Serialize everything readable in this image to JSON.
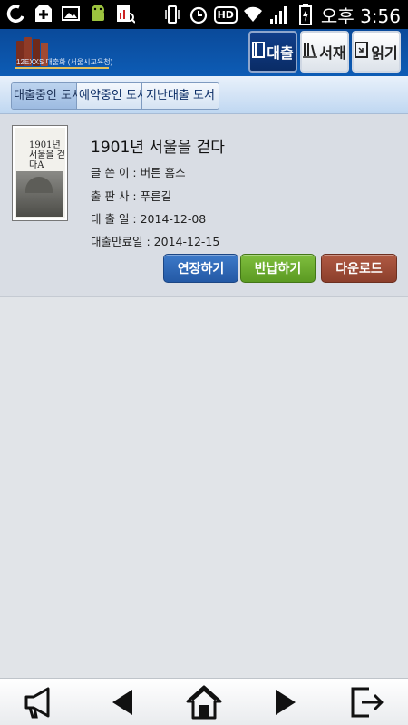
{
  "status_bar": {
    "left_icons": [
      "g-app-icon",
      "plus-icon",
      "image-icon",
      "android-icon",
      "chart-search-icon"
    ],
    "right_icons": [
      "vibrate-icon",
      "alarm-icon",
      "hd-icon",
      "wifi-icon",
      "signal-icon",
      "battery-icon"
    ],
    "hd_label": "HD",
    "time": "오후 3:56"
  },
  "header": {
    "logo_text": "12EXXS 대출화 (서울시교육청)",
    "tabs": [
      {
        "label": "대출",
        "icon": "book-icon",
        "active": true
      },
      {
        "label": "서재",
        "icon": "bookshelf-icon",
        "active": false
      },
      {
        "label": "읽기",
        "icon": "read-icon",
        "active": false
      }
    ]
  },
  "subtabs": [
    {
      "label": "대출중인 도서",
      "active": true
    },
    {
      "label": "예약중인 도서",
      "active": false
    },
    {
      "label": "지난대출 도서",
      "active": false
    }
  ],
  "book": {
    "title": "1901년 서울을 걷다",
    "cover_text": "1901년 서울을 걷다A",
    "author_label": "글 쓴 이 : ",
    "author": "버튼 홈스",
    "publisher_label": "출 판 사 : ",
    "publisher": "푸른길",
    "loan_date_label": "대 출 일 : ",
    "loan_date": "2014-12-08",
    "due_date_label": "대출만료일 : ",
    "due_date": "2014-12-15",
    "buttons": {
      "extend": "연장하기",
      "return": "반납하기",
      "download": "다운로드"
    }
  },
  "bottom_nav": [
    "megaphone-icon",
    "back-icon",
    "home-icon",
    "forward-icon",
    "logout-icon"
  ],
  "colors": {
    "header_blue": "#0d5cb5",
    "extend_blue": "#2459a5",
    "return_green": "#5b9a22",
    "download_brown": "#8c3f2c"
  }
}
